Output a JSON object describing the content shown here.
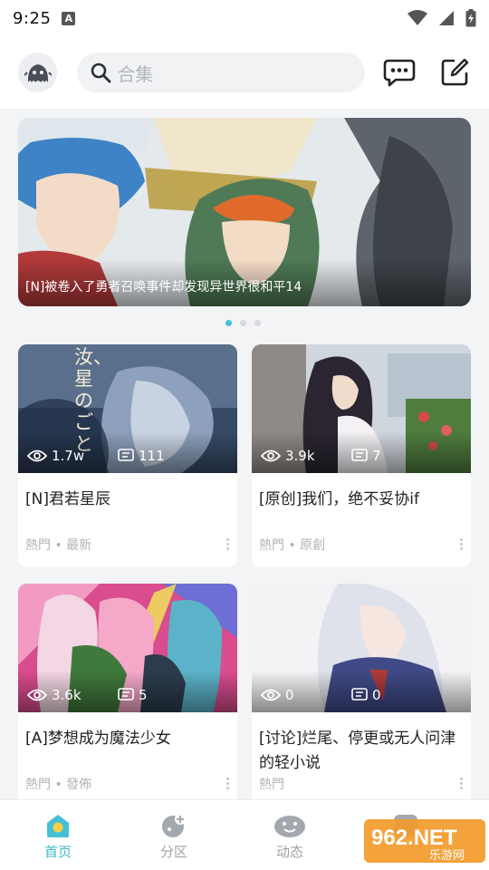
{
  "status_bar": {
    "time": "9:25",
    "notice_icon": "A"
  },
  "header": {
    "avatar_icon": "ghost-avatar-icon",
    "search_placeholder": "合集",
    "message_icon": "chat-bubble-icon",
    "compose_icon": "edit-icon"
  },
  "banner": {
    "caption": "[N]被卷入了勇者召唤事件却发现异世界很和平14",
    "dots": 3,
    "active_dot": 0
  },
  "cards": [
    {
      "views": "1.7w",
      "comments": "111",
      "title": "[N]君若星辰",
      "meta": "熱門 • 最新",
      "cover_text": "汝、星のごと"
    },
    {
      "views": "3.9k",
      "comments": "7",
      "title": "[原创]我们，绝不妥协if",
      "meta": "熱門 • 原創"
    },
    {
      "views": "3.6k",
      "comments": "5",
      "title": "[A]梦想成为魔法少女",
      "meta": "熱門 • 發佈"
    },
    {
      "views": "0",
      "comments": "0",
      "title": "[讨论]烂尾、停更或无人问津的轻小说",
      "meta": "熱門"
    }
  ],
  "nav": [
    {
      "label": "首页",
      "active": true
    },
    {
      "label": "分区",
      "active": false
    },
    {
      "label": "动态",
      "active": false
    },
    {
      "label": "",
      "active": false
    }
  ],
  "watermark": {
    "text": "962.NET",
    "sub": "乐游网"
  },
  "colors": {
    "accent": "#49c0d6"
  }
}
